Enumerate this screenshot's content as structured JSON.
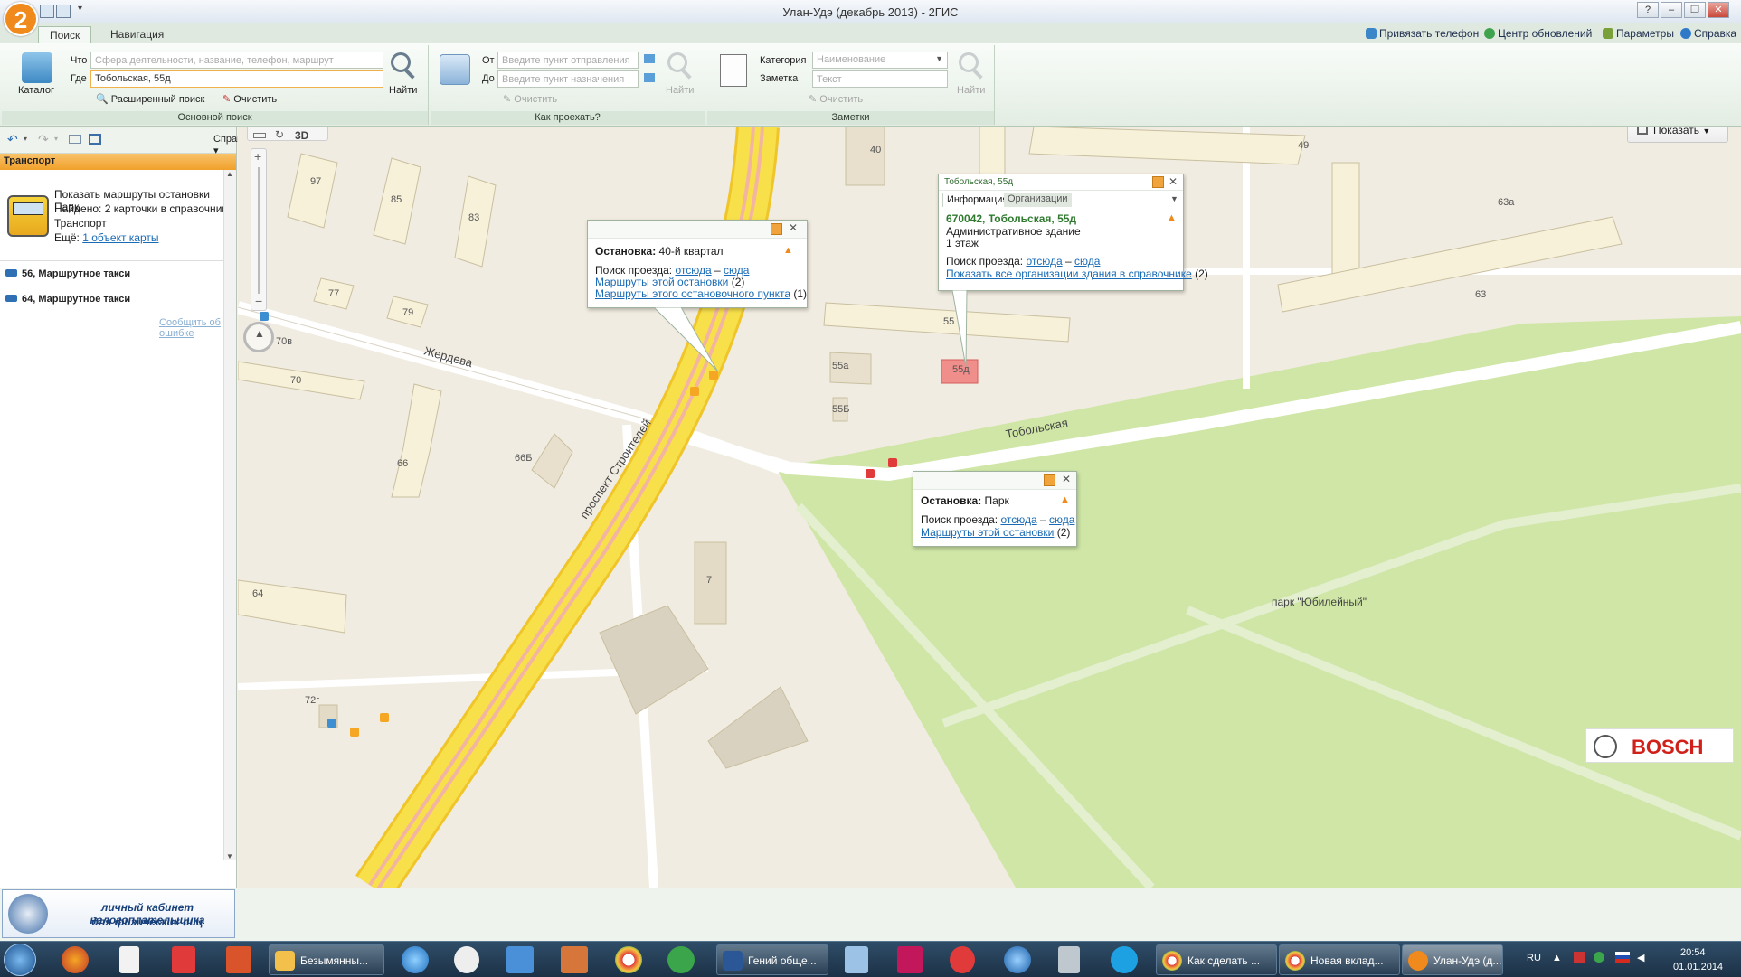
{
  "window": {
    "title": "Улан-Удэ (декабрь 2013) - 2ГИС",
    "logo": "2"
  },
  "ribbon": {
    "tabs": [
      "Поиск",
      "Навигация"
    ],
    "top_links": [
      "Привязать телефон",
      "Центр обновлений",
      "Параметры",
      "Справка"
    ],
    "search": {
      "catalog_label": "Каталог",
      "what_label": "Что",
      "what_placeholder": "Сфера деятельности, название, телефон, маршрут",
      "where_label": "Где",
      "where_value": "Тобольская, 55д",
      "find_label": "Найти",
      "advanced_label": "Расширенный поиск",
      "clear_label": "Очистить",
      "group_label": "Основной поиск"
    },
    "route": {
      "from_label": "От",
      "from_placeholder": "Введите пункт отправления",
      "to_label": "До",
      "to_placeholder": "Введите пункт назначения",
      "find_label": "Найти",
      "clear_label": "Очистить",
      "group_label": "Как проехать?"
    },
    "notes": {
      "category_label": "Категория",
      "category_placeholder": "Наименование",
      "note_label": "Заметка",
      "note_placeholder": "Текст",
      "find_label": "Найти",
      "clear_label": "Очистить",
      "group_label": "Заметки"
    }
  },
  "left_panel": {
    "directories_label": "Справочники",
    "section_header": "Транспорт",
    "result_title": "Показать маршруты остановки Парк",
    "result_found": "Найдено: 2 карточки в справочнике",
    "result_category": "Транспорт",
    "result_more_prefix": "Ещё:",
    "result_more_link": "1 объект карты",
    "routes": [
      "56, Маршрутное такси",
      "64, Маршрутное такси"
    ],
    "report_error": "Сообщить об ошибке",
    "banner_line1": "личный кабинет налогоплательщика",
    "banner_line2": "для физических лиц"
  },
  "map": {
    "show_button": "Показать",
    "mode_3d": "3D",
    "bosch": "BOSCH",
    "street_zherdeva": "Жердева",
    "street_stroiteley": "проспект Строителей",
    "street_tobolskaya": "Тобольская",
    "park_label": "парк \"Юбилейный\"",
    "buildings": [
      "97",
      "85",
      "83",
      "77",
      "79",
      "70в",
      "70",
      "66",
      "66Б",
      "64",
      "72г",
      "7",
      "40",
      "49",
      "63а",
      "55",
      "55а",
      "55Б",
      "55д",
      "63"
    ],
    "popup_stop_40": {
      "title_prefix": "Остановка:",
      "title_value": "40-й квартал",
      "route_search": "Поиск проезда:",
      "from_here": "отсюда",
      "dash": "–",
      "to_here": "сюда",
      "stop_routes_link": "Маршруты этой остановки",
      "stop_routes_count": "(2)",
      "point_routes_link": "Маршруты этого остановочного пункта",
      "point_routes_count": "(1)"
    },
    "popup_building": {
      "header": "Тобольская, 55д",
      "tab_info": "Информация",
      "tab_orgs": "Организации",
      "address": "670042, Тобольская, 55д",
      "type": "Административное здание",
      "floors": "1 этаж",
      "route_search": "Поиск проезда:",
      "from_here": "отсюда",
      "dash": "–",
      "to_here": "сюда",
      "orgs_link": "Показать все организации здания в справочнике",
      "orgs_count": "(2)"
    },
    "popup_stop_park": {
      "title_prefix": "Остановка:",
      "title_value": "Парк",
      "route_search": "Поиск проезда:",
      "from_here": "отсюда",
      "dash": "–",
      "to_here": "сюда",
      "stop_routes_link": "Маршруты этой остановки",
      "stop_routes_count": "(2)"
    }
  },
  "taskbar": {
    "buttons": [
      "Безымянны...",
      "Гений обще...",
      "Как сделать ...",
      "Новая вклад...",
      "Улан-Удэ (д..."
    ],
    "lang": "RU",
    "time": "20:54",
    "date": "01.01.2014"
  },
  "colors": {
    "accent_orange": "#f08a1c",
    "link_blue": "#1a6bb5",
    "road_yellow": "#f7e04a",
    "park_green": "#cfe6a6"
  }
}
